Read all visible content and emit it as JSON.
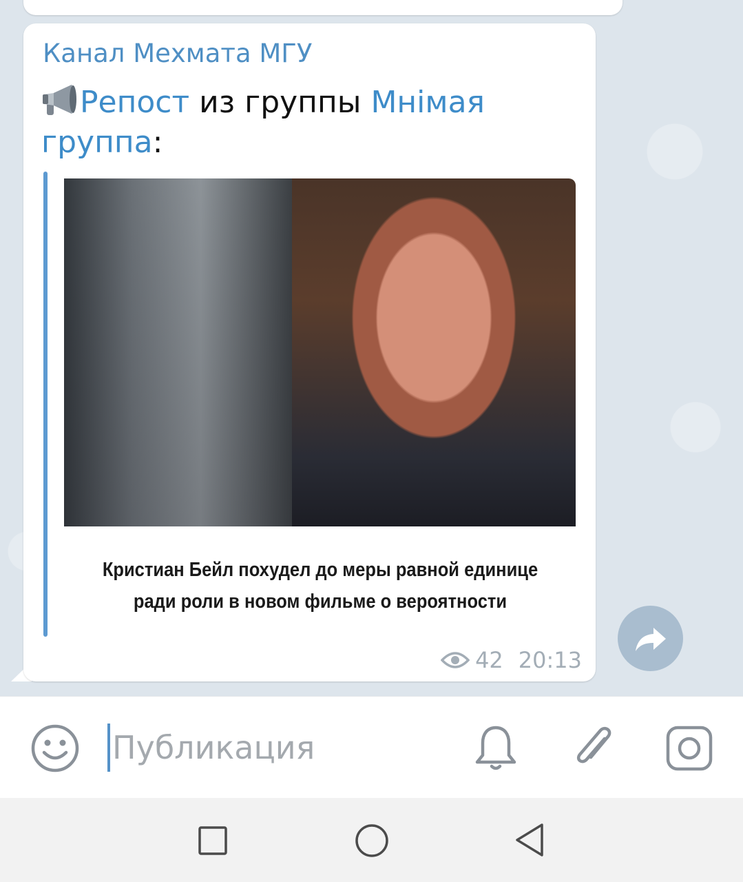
{
  "message": {
    "sender": "Канал Мехмата МГУ",
    "repost_link": "Репост",
    "repost_text": " из группы ",
    "group_link": "Мнімая группа",
    "repost_tail": ":",
    "image_caption_line1": "Кристиан Бейл похудел до меры равной единице",
    "image_caption_line2": "ради роли в новом фильме о вероятности",
    "views": "42",
    "time": "20:13"
  },
  "composer": {
    "placeholder": "Публикация"
  },
  "icons": {
    "megaphone": "megaphone-icon",
    "views": "eye-icon",
    "forward": "forward-icon",
    "emoji": "smiley-icon",
    "bell": "bell-icon",
    "attach": "paperclip-icon",
    "camera": "camera-icon"
  },
  "colors": {
    "link": "#3e8cc9",
    "sender": "#4f8fc4",
    "quote_bar": "#5d9ad1",
    "forward_button": "#a9bdcf",
    "meta_text": "#a3adb6"
  }
}
